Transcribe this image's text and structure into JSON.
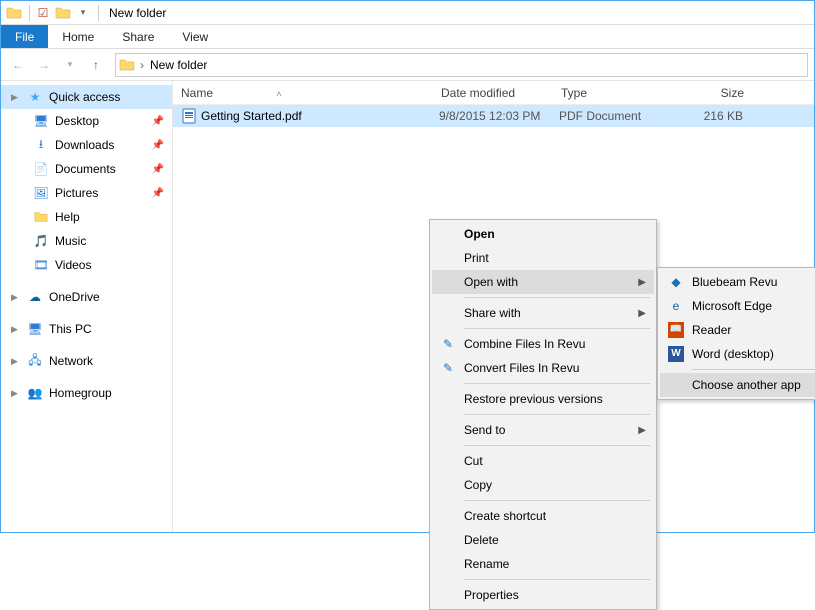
{
  "titlebar": {
    "title": "New folder"
  },
  "ribbon": {
    "file": "File",
    "home": "Home",
    "share": "Share",
    "view": "View"
  },
  "breadcrumb": {
    "root": "",
    "folder": "New folder"
  },
  "columns": {
    "name": "Name",
    "date": "Date modified",
    "type": "Type",
    "size": "Size"
  },
  "row": {
    "name": "Getting Started.pdf",
    "date": "9/8/2015 12:03 PM",
    "type": "PDF Document",
    "size": "216 KB"
  },
  "sidebar": {
    "quick": "Quick access",
    "desktop": "Desktop",
    "downloads": "Downloads",
    "documents": "Documents",
    "pictures": "Pictures",
    "help": "Help",
    "music": "Music",
    "videos": "Videos",
    "onedrive": "OneDrive",
    "thispc": "This PC",
    "network": "Network",
    "homegroup": "Homegroup"
  },
  "ctx": {
    "open": "Open",
    "print": "Print",
    "open_with": "Open with",
    "share_with": "Share with",
    "combine": "Combine Files In Revu",
    "convert": "Convert Files In Revu",
    "restore": "Restore previous versions",
    "send_to": "Send to",
    "cut": "Cut",
    "copy": "Copy",
    "shortcut": "Create shortcut",
    "delete": "Delete",
    "rename": "Rename",
    "properties": "Properties"
  },
  "openwith": {
    "bluebeam": "Bluebeam Revu",
    "edge": "Microsoft Edge",
    "reader": "Reader",
    "word": "Word (desktop)",
    "choose": "Choose another app"
  }
}
